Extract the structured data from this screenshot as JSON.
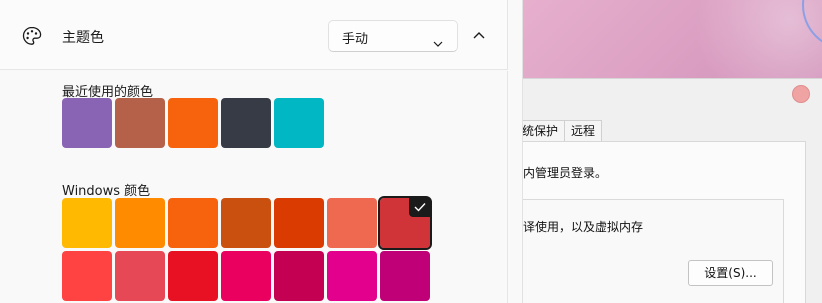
{
  "settings": {
    "accent_title": "主题色",
    "mode_value": "手动",
    "recent_label": "最近使用的颜色",
    "windows_label": "Windows 颜色"
  },
  "recent_colors": [
    "#8963b4",
    "#b5614a",
    "#f7630c",
    "#363b45",
    "#00b7c3"
  ],
  "windows_colors_row1": [
    "#ffb900",
    "#ff8c00",
    "#f7630c",
    "#ca5010",
    "#da3b01",
    "#ef6950",
    "#d13438"
  ],
  "windows_colors_row2": [
    "#ff4343",
    "#e74856",
    "#e81123",
    "#ea005e",
    "#c30052",
    "#e3008c",
    "#bf0077"
  ],
  "selected_color": "#d13438",
  "icons": {
    "palette": "palette-icon",
    "dropdown": "chevron-down-icon",
    "collapse": "chevron-up-icon",
    "check": "checkmark-icon"
  },
  "system_dialog": {
    "tab_protection": "统保护",
    "tab_remote": "远程",
    "admin_note": "内管理员登录。",
    "perf_desc": "译使用，以及虚拟内存",
    "settings_button": "设置(S)..."
  }
}
